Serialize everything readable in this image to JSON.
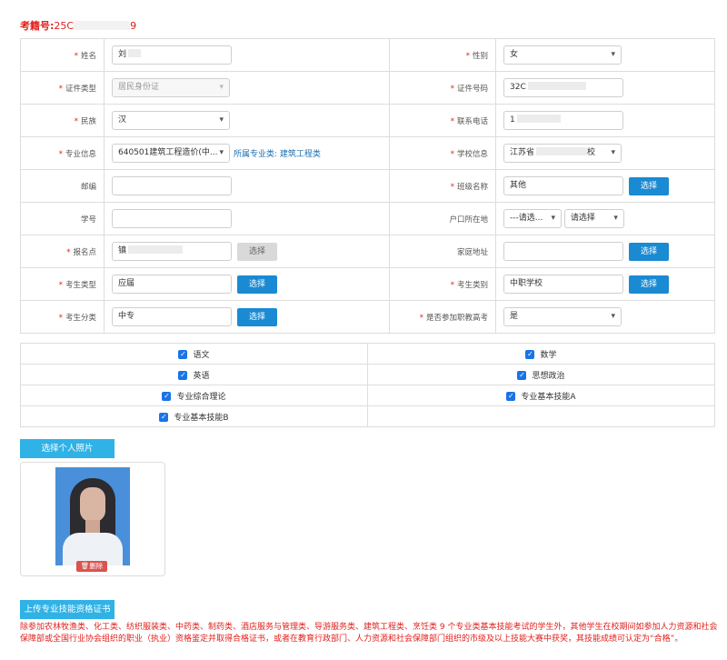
{
  "header": {
    "exam_label": "考籍号:",
    "exam_prefix": "25C",
    "exam_suffix": "9"
  },
  "form": {
    "name": {
      "label": "姓名",
      "value": "刘"
    },
    "gender": {
      "label": "性别",
      "value": "女"
    },
    "id_type": {
      "label": "证件类型",
      "value": "居民身份证"
    },
    "id_number": {
      "label": "证件号码",
      "value": "32C"
    },
    "ethnicity": {
      "label": "民族",
      "value": "汉"
    },
    "phone": {
      "label": "联系电话",
      "value": "1"
    },
    "major": {
      "label": "专业信息",
      "value": "640501建筑工程造价(中...",
      "category_text": "所属专业类: 建筑工程类"
    },
    "school": {
      "label": "学校信息",
      "value": "江苏省",
      "value_tail": "校"
    },
    "postcode": {
      "label": "邮编",
      "value": ""
    },
    "class_name": {
      "label": "班级名称",
      "value": "其他",
      "button": "选择"
    },
    "student_no": {
      "label": "学号",
      "value": ""
    },
    "household": {
      "label": "户口所在地",
      "select1": "---请选...",
      "select2": "请选择"
    },
    "exam_site": {
      "label": "报名点",
      "value": "镇",
      "button": "选择"
    },
    "home_address": {
      "label": "家庭地址",
      "value": "",
      "button": "选择"
    },
    "candidate_type": {
      "label": "考生类型",
      "value": "应届",
      "button": "选择"
    },
    "candidate_category": {
      "label": "考生类别",
      "value": "中职学校",
      "button": "选择"
    },
    "candidate_class": {
      "label": "考生分类",
      "value": "中专",
      "button": "选择"
    },
    "vocational_exam": {
      "label": "是否参加职教高考",
      "value": "是"
    }
  },
  "subjects": [
    {
      "label": "语文",
      "checked": true
    },
    {
      "label": "数学",
      "checked": true
    },
    {
      "label": "英语",
      "checked": true
    },
    {
      "label": "思想政治",
      "checked": true
    },
    {
      "label": "专业综合理论",
      "checked": true
    },
    {
      "label": "专业基本技能A",
      "checked": true
    },
    {
      "label": "专业基本技能B",
      "checked": true
    }
  ],
  "photo": {
    "select_button": "选择个人照片",
    "delete_button": "删除"
  },
  "certificate": {
    "upload_button": "上传专业技能资格证书",
    "note": "除参加农林牧渔类、化工类、纺织服装类、中药类、制药类、酒店服务与管理类、导游服务类、建筑工程类、烹饪类 9 个专业类基本技能考试的学生外，其他学生在校期间如参加人力资源和社会保障部或全国行业协会组织的职业（执业）资格鉴定并取得合格证书，或者在教育行政部门、人力资源和社会保障部门组织的市级及以上技能大赛中获奖，其技能成绩可认定为“合格”。"
  },
  "colors": {
    "accent": "#1a8ad3",
    "required": "#e0201c",
    "light_button": "#2fb2e6"
  }
}
